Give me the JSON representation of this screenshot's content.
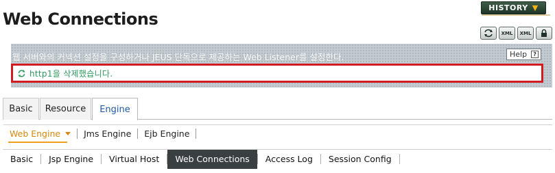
{
  "header": {
    "title": "Web Connections",
    "history_label": "HISTORY",
    "tool_icons": [
      {
        "name": "refresh-icon",
        "label": ""
      },
      {
        "name": "xml-icon",
        "label": "XML"
      },
      {
        "name": "xml-export-icon",
        "label": "XML"
      },
      {
        "name": "lock-icon",
        "label": ""
      }
    ]
  },
  "banner": {
    "description": "웹 서버와의 커넥션 설정을 구성하거나 JEUS 단독으로 제공하는 Web Listener를 설정한다.",
    "help_label": "Help",
    "help_icon_label": "?",
    "message": "http1을 삭제했습니다."
  },
  "top_tabs": [
    {
      "label": "Basic",
      "active": false
    },
    {
      "label": "Resource",
      "active": false
    },
    {
      "label": "Engine",
      "active": true
    }
  ],
  "engine_tabs": [
    {
      "label": "Web Engine",
      "active": true
    },
    {
      "label": "Jms Engine",
      "active": false
    },
    {
      "label": "Ejb Engine",
      "active": false
    }
  ],
  "sub_tabs": [
    {
      "label": "Basic",
      "active": false
    },
    {
      "label": "Jsp Engine",
      "active": false
    },
    {
      "label": "Virtual Host",
      "active": false
    },
    {
      "label": "Web Connections",
      "active": true
    },
    {
      "label": "Access Log",
      "active": false
    },
    {
      "label": "Session Config",
      "active": false
    }
  ],
  "colors": {
    "active_tab": "#1f59a8",
    "engine_accent": "#d6880c",
    "message_border": "#d21a22",
    "message_text": "#2c9a5e",
    "history_bg": "#2c4535"
  }
}
